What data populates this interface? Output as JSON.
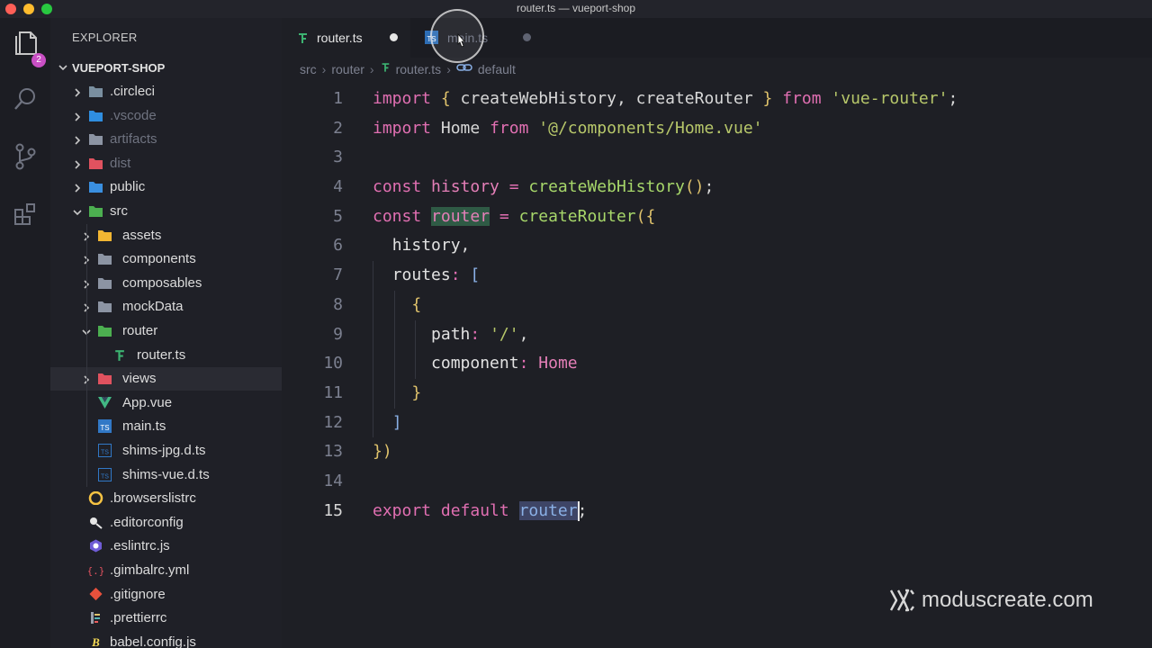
{
  "window": {
    "title": "router.ts — vueport-shop"
  },
  "activity_bar": {
    "items": [
      {
        "icon": "files-icon",
        "badge": "2"
      },
      {
        "icon": "search-icon"
      },
      {
        "icon": "source-control-icon"
      },
      {
        "icon": "extensions-icon"
      }
    ]
  },
  "sidebar": {
    "header": "EXPLORER",
    "project": "VUEPORT-SHOP",
    "items": [
      {
        "label": ".circleci",
        "type": "folder",
        "icon": "circleci-folder-icon",
        "color": "#7a8fa0",
        "dim": false
      },
      {
        "label": ".vscode",
        "type": "folder",
        "icon": "vscode-folder-icon",
        "color": "#2f8ee0",
        "dim": true
      },
      {
        "label": "artifacts",
        "type": "folder",
        "icon": "folder-icon",
        "color": "#8c94a3",
        "dim": true
      },
      {
        "label": "dist",
        "type": "folder",
        "icon": "dist-folder-icon",
        "color": "#e0525f",
        "dim": true
      },
      {
        "label": "public",
        "type": "folder",
        "icon": "public-folder-icon",
        "color": "#3a8fe0",
        "dim": false
      },
      {
        "label": "src",
        "type": "folder-open",
        "icon": "src-folder-icon",
        "color": "#4caf50",
        "dim": false
      },
      {
        "label": "assets",
        "type": "folder",
        "icon": "assets-folder-icon",
        "color": "#f2b632",
        "dim": false
      },
      {
        "label": "components",
        "type": "folder",
        "icon": "folder-icon",
        "color": "#8c94a3",
        "dim": false
      },
      {
        "label": "composables",
        "type": "folder",
        "icon": "folder-icon",
        "color": "#8c94a3",
        "dim": false
      },
      {
        "label": "mockData",
        "type": "folder",
        "icon": "folder-icon",
        "color": "#8c94a3",
        "dim": false
      },
      {
        "label": "router",
        "type": "folder-open",
        "icon": "router-folder-icon",
        "color": "#4caf50",
        "dim": false
      },
      {
        "label": "router.ts",
        "type": "file",
        "icon": "router-file-icon",
        "color": "#3cb371",
        "dim": false
      },
      {
        "label": "views",
        "type": "folder",
        "icon": "views-folder-icon",
        "color": "#e0525f",
        "dim": false
      },
      {
        "label": "App.vue",
        "type": "file",
        "icon": "vue-icon",
        "color": "#41b883",
        "dim": false
      },
      {
        "label": "main.ts",
        "type": "file",
        "icon": "typescript-icon",
        "color": "#3178c6",
        "dim": false
      },
      {
        "label": "shims-jpg.d.ts",
        "type": "file",
        "icon": "typescript-def-icon",
        "color": "#3178c6",
        "dim": false
      },
      {
        "label": "shims-vue.d.ts",
        "type": "file",
        "icon": "typescript-def-icon",
        "color": "#3178c6",
        "dim": false
      },
      {
        "label": ".browserslistrc",
        "type": "file",
        "icon": "browserslist-icon",
        "color": "#f6c343",
        "dim": false
      },
      {
        "label": ".editorconfig",
        "type": "file",
        "icon": "editorconfig-icon",
        "color": "#e6e6e6",
        "dim": false
      },
      {
        "label": ".eslintrc.js",
        "type": "file",
        "icon": "eslint-icon",
        "color": "#6f5cd6",
        "dim": false
      },
      {
        "label": ".gimbalrc.yml",
        "type": "file",
        "icon": "yaml-icon",
        "color": "#e0525f",
        "dim": false
      },
      {
        "label": ".gitignore",
        "type": "file",
        "icon": "git-icon",
        "color": "#e8513c",
        "dim": false
      },
      {
        "label": ".prettierrc",
        "type": "file",
        "icon": "prettier-icon",
        "color": "#9aa0ac",
        "dim": false
      },
      {
        "label": "babel.config.js",
        "type": "file",
        "icon": "babel-icon",
        "color": "#f5da55",
        "dim": false
      }
    ]
  },
  "tabs": [
    {
      "label": "router.ts",
      "icon": "router-file-icon",
      "active": true,
      "modified": true
    },
    {
      "label": "main.ts",
      "icon": "typescript-icon",
      "active": false,
      "modified": true
    }
  ],
  "breadcrumb": {
    "parts": [
      "src",
      "router",
      "router.ts",
      "default"
    ],
    "symbol_icon": "symbol-field-icon"
  },
  "editor": {
    "lines": [
      "1",
      "2",
      "3",
      "4",
      "5",
      "6",
      "7",
      "8",
      "9",
      "10",
      "11",
      "12",
      "13",
      "14",
      "15"
    ],
    "current_line": "15"
  },
  "watermark": {
    "text": "moduscreate.com",
    "icon": "modus-logo-icon"
  },
  "colors": {
    "keyword": "#e16fb2",
    "string": "#b7c76a",
    "function": "#a7d76a",
    "badge": "#c94fc4"
  }
}
